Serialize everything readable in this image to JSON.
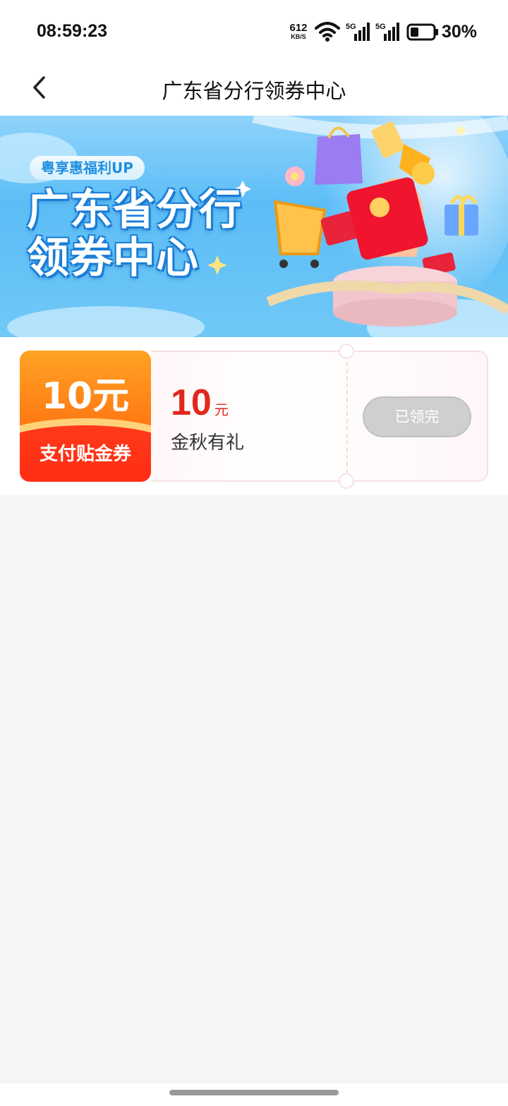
{
  "status_bar": {
    "time": "08:59:23",
    "net_speed_value": "612",
    "net_speed_unit": "KB/S",
    "battery_percent": "30%",
    "icons": [
      "wifi-icon",
      "signal-5g-icon",
      "signal-5g-icon",
      "battery-icon"
    ],
    "signal_label": "5G"
  },
  "nav": {
    "title": "广东省分行领券中心",
    "back_icon": "chevron-left-icon"
  },
  "banner": {
    "tag": "粤享惠福利UP",
    "title_line1": "广东省分行",
    "title_line2": "领券中心"
  },
  "coupon": {
    "left_amount": "10元",
    "left_type": "支付贴金券",
    "value": "10",
    "unit": "元",
    "name": "金秋有礼",
    "button_label": "已领完"
  },
  "colors": {
    "accent_red": "#e0281c",
    "coupon_orange": "#ff7a14",
    "banner_blue": "#5cbdf6",
    "disabled_gray": "#cfcfcf"
  }
}
